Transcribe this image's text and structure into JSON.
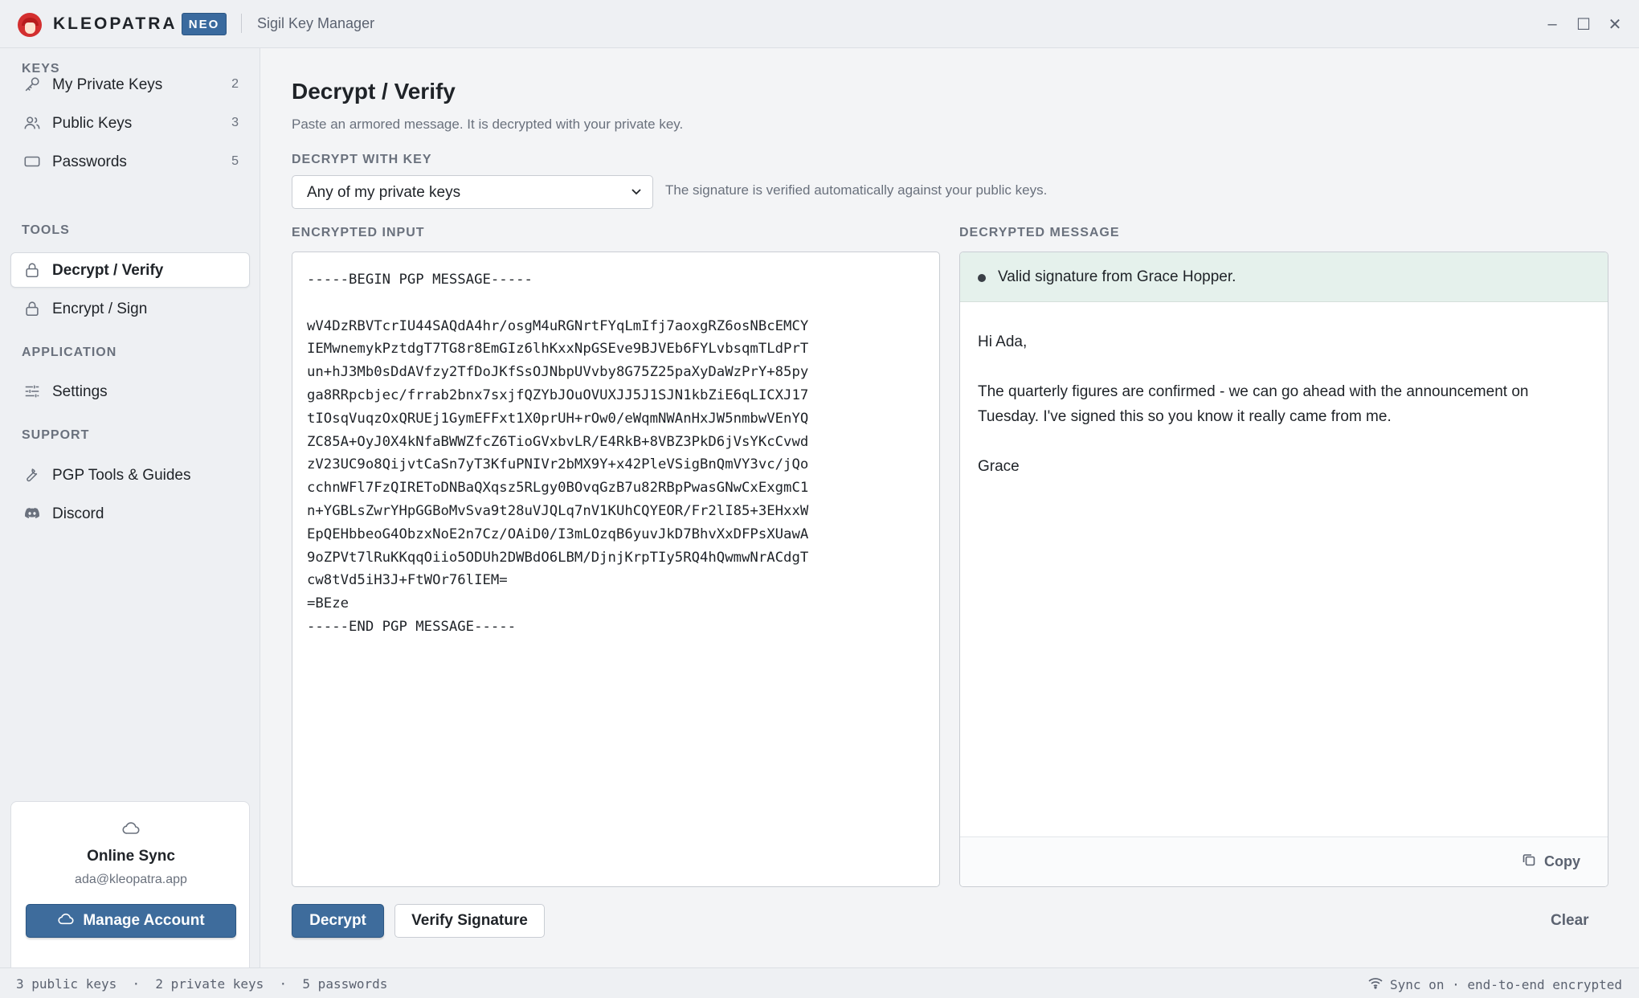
{
  "titlebar": {
    "app_name": "KLEOPATRA",
    "badge": "NEO",
    "window_title": "Sigil Key Manager",
    "controls": {
      "minimize": "–",
      "maximize": "☐",
      "close": "✕"
    }
  },
  "sidebar": {
    "sections": {
      "keys": "KEYS",
      "tools": "TOOLS",
      "application": "APPLICATION",
      "support": "SUPPORT"
    },
    "items": [
      {
        "label": "My Private Keys",
        "count": "2",
        "icon": "key-icon"
      },
      {
        "label": "Public Keys",
        "count": "3",
        "icon": "users-icon"
      },
      {
        "label": "Passwords",
        "count": "5",
        "icon": "password-icon"
      },
      {
        "label": "Decrypt / Verify",
        "icon": "lock-icon",
        "active": true
      },
      {
        "label": "Encrypt / Sign",
        "icon": "lock-icon"
      },
      {
        "label": "Settings",
        "icon": "sliders-icon"
      },
      {
        "label": "PGP Tools & Guides",
        "icon": "wrench-icon"
      },
      {
        "label": "Discord",
        "icon": "discord-icon"
      }
    ],
    "sync": {
      "title": "Online Sync",
      "email": "ada@kleopatra.app",
      "button": "Manage Account"
    }
  },
  "main": {
    "title": "Decrypt / Verify",
    "subtitle": "Paste an armored message. It is decrypted with your private key.",
    "key_label": "DECRYPT WITH KEY",
    "key_selected": "Any of my private keys",
    "key_hint": "The signature is verified automatically against your public keys.",
    "input_label": "ENCRYPTED INPUT",
    "input_value": "-----BEGIN PGP MESSAGE-----\n\nwV4DzRBVTcrIU44SAQdA4hr/osgM4uRGNrtFYqLmIfj7aoxgRZ6osNBcEMCY\nIEMwnemykPztdgT7TG8r8EmGIz6lhKxxNpGSEve9BJVEb6FYLvbsqmTLdPrT\nun+hJ3Mb0sDdAVfzy2TfDoJKfSsOJNbpUVvby8G75Z25paXyDaWzPrY+85py\nga8RRpcbjec/frrab2bnx7sxjfQZYbJOuOVUXJJ5J1SJN1kbZiE6qLICXJ17\ntIOsqVuqzOxQRUEj1GymEFFxt1X0prUH+rOw0/eWqmNWAnHxJW5nmbwVEnYQ\nZC85A+OyJ0X4kNfaBWWZfcZ6TioGVxbvLR/E4RkB+8VBZ3PkD6jVsYKcCvwd\nzV23UC9o8QijvtCaSn7yT3KfuPNIVr2bMX9Y+x42PleVSigBnQmVY3vc/jQo\ncchnWFl7FzQIREToDNBaQXqsz5RLgy0BOvqGzB7u82RBpPwasGNwCxExgmC1\nn+YGBLsZwrYHpGGBoMvSva9t28uVJQLq7nV1KUhCQYEOR/Fr2lI85+3EHxxW\nEpQEHbbeoG4ObzxNoE2n7Cz/OAiD0/I3mLOzqB6yuvJkD7BhvXxDFPsXUawA\n9oZPVt7lRuKKqqOiio5ODUh2DWBdO6LBM/DjnjKrpTIy5RQ4hQwmwNrACdgT\ncw8tVd5iH3J+FtWOr76lIEM=\n=BEze\n-----END PGP MESSAGE-----",
    "output_label": "DECRYPTED MESSAGE",
    "signature_status": "Valid signature from Grace Hopper.",
    "message": [
      "Hi Ada,",
      "The quarterly figures are confirmed - we can go ahead with the announcement on Tuesday. I've signed this so you know it really came from me.",
      "Grace"
    ],
    "copy_label": "Copy",
    "decrypt_label": "Decrypt",
    "verify_label": "Verify Signature",
    "clear_label": "Clear"
  },
  "statusbar": {
    "left": "3 public keys  ·  2 private keys  ·  5 passwords",
    "right": "Sync on · end-to-end encrypted"
  },
  "colors": {
    "accent": "#3e6c9c",
    "brand_red": "#d32f2f",
    "success_bg": "#e5f1ec"
  }
}
